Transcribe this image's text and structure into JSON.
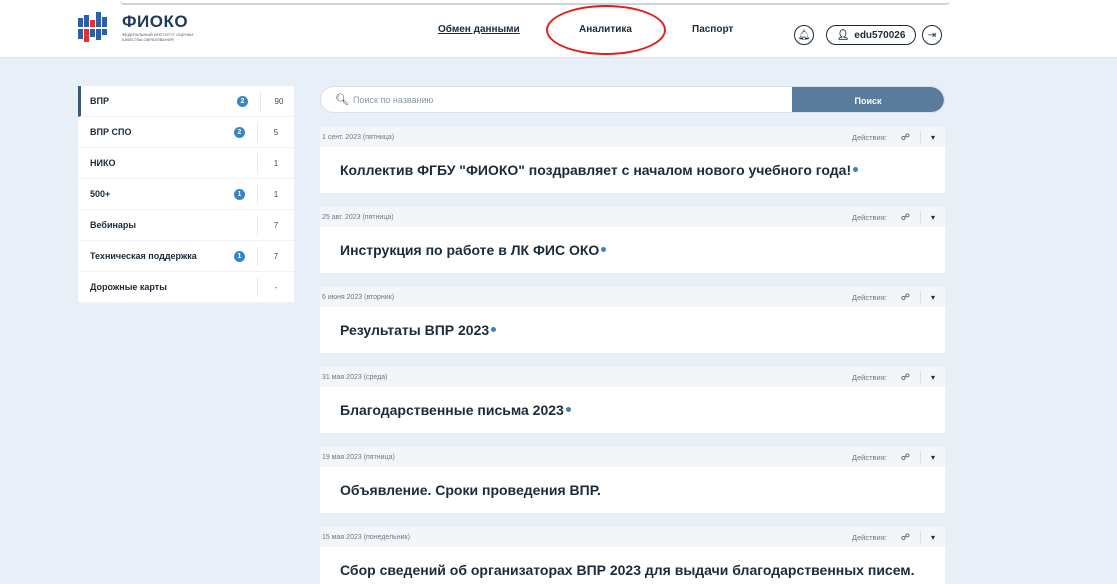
{
  "header": {
    "logo_title": "ФИОКО",
    "logo_subtitle": "Федеральный институт оценки качества образования",
    "nav": {
      "exchange": "Обмен данными",
      "analytics": "Аналитика",
      "passport": "Паспорт"
    },
    "user": "edu570026"
  },
  "colors": {
    "accent": "#5a7c9c",
    "badge": "#3b82c4",
    "annotation": "#e0201a"
  },
  "sidebar": {
    "items": [
      {
        "label": "ВПР",
        "badge": "2",
        "count": "90"
      },
      {
        "label": "ВПР СПО",
        "badge": "2",
        "count": "5"
      },
      {
        "label": "НИКО",
        "badge": "",
        "count": "1"
      },
      {
        "label": "500+",
        "badge": "1",
        "count": "1"
      },
      {
        "label": "Вебинары",
        "badge": "",
        "count": "7"
      },
      {
        "label": "Техническая поддержка",
        "badge": "1",
        "count": "7"
      },
      {
        "label": "Дорожные карты",
        "badge": "",
        "count": "-"
      }
    ]
  },
  "search": {
    "placeholder": "Поиск по названию",
    "button": "Поиск"
  },
  "news": {
    "actions_label": "Действия:",
    "items": [
      {
        "date": "1 сент. 2023 (пятница)",
        "title": "Коллектив ФГБУ \"ФИОКО\" поздравляет с началом нового учебного года!"
      },
      {
        "date": "25 авг. 2023 (пятница)",
        "title": "Инструкция по работе в ЛК ФИС ОКО"
      },
      {
        "date": "6 июня 2023 (вторник)",
        "title": "Результаты ВПР 2023"
      },
      {
        "date": "31 мая 2023 (среда)",
        "title": "Благодарственные письма 2023"
      },
      {
        "date": "19 мая 2023 (пятница)",
        "title": "Объявление. Сроки проведения ВПР."
      },
      {
        "date": "15 мая 2023 (понедельник)",
        "title": "Сбор сведений об организаторах ВПР 2023 для выдачи благодарственных писем."
      }
    ]
  }
}
